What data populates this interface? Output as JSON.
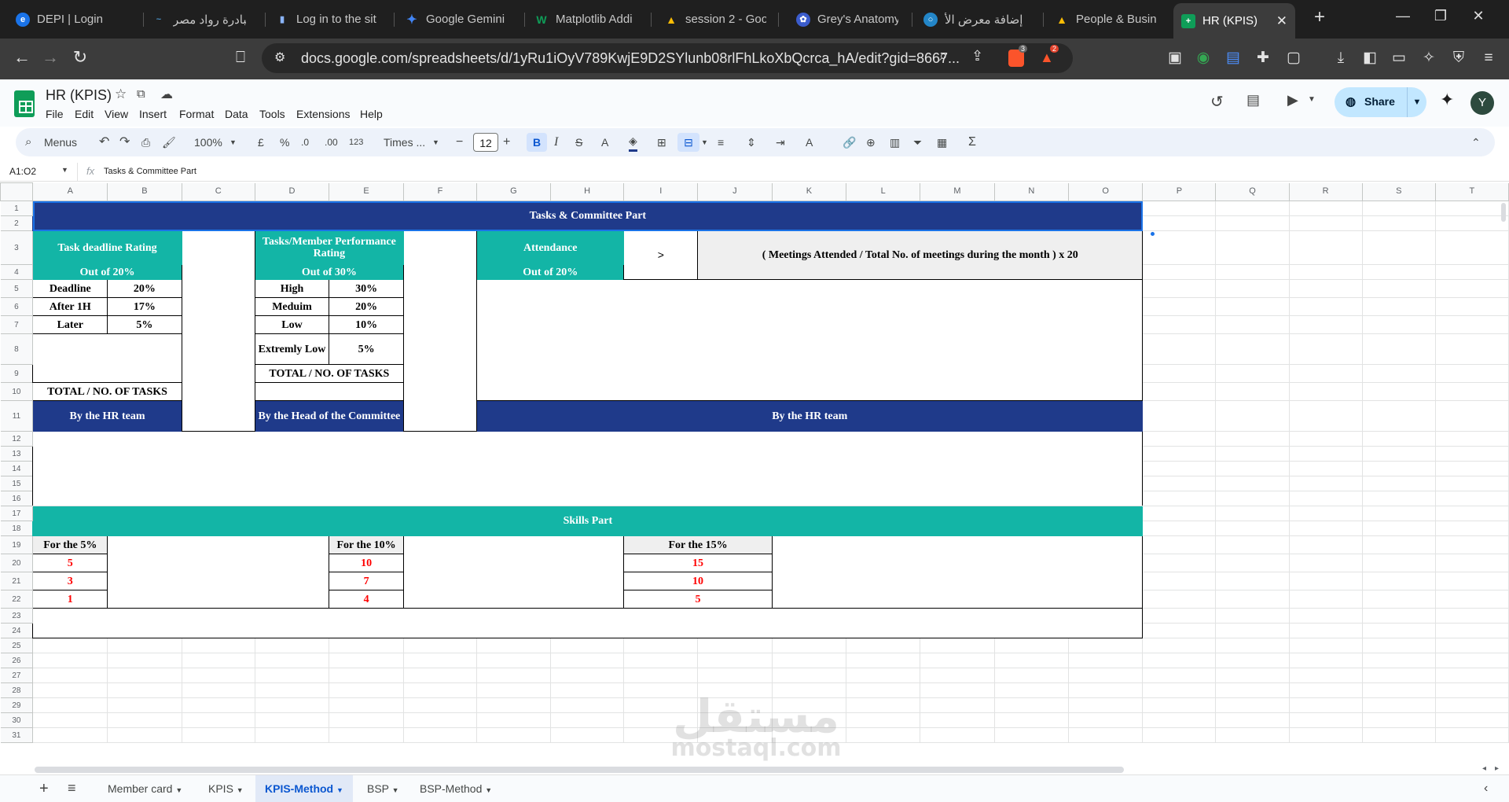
{
  "tabs": [
    {
      "title": "DEPI | Login",
      "icon": "depi-icon",
      "color": "#1a73e8",
      "glyph": "e"
    },
    {
      "title": "مبادرة رواد مصر",
      "icon": "rowad-icon",
      "color": "#4a90c4",
      "glyph": "~"
    },
    {
      "title": "Log in to the sit",
      "icon": "bookmark-icon",
      "color": "#8ab4f8",
      "glyph": "▮"
    },
    {
      "title": "Google Gemini",
      "icon": "gemini-icon",
      "color": "#4285f4",
      "glyph": "✦"
    },
    {
      "title": "Matplotlib Addi",
      "icon": "w-icon",
      "color": "#0f9d58",
      "glyph": "W"
    },
    {
      "title": "session 2 - Goo",
      "icon": "drive-icon",
      "color": "#fbbc04",
      "glyph": "▲"
    },
    {
      "title": "Grey's Anatomy",
      "icon": "grey-icon",
      "color": "#3b5ccc",
      "glyph": "✿"
    },
    {
      "title": "إضافة معرض الأ",
      "icon": "mostaql-icon",
      "color": "#2386c8",
      "glyph": "○"
    },
    {
      "title": "People & Busin",
      "icon": "drive-icon",
      "color": "#fbbc04",
      "glyph": "▲"
    },
    {
      "title": "HR (KPIS)",
      "icon": "sheets-icon",
      "color": "#0f9d58",
      "glyph": "+"
    }
  ],
  "url": "docs.google.com/spreadsheets/d/1yRu1iOyV789KwjE9D2SYlunb08rlFhLkoXbQcrca_hA/edit?gid=8667...",
  "ext_badges": {
    "brave": "3",
    "alert": "2"
  },
  "doc": {
    "title": "HR (KPIS)",
    "menus": [
      "File",
      "Edit",
      "View",
      "Insert",
      "Format",
      "Data",
      "Tools",
      "Extensions",
      "Help"
    ],
    "share_label": "Share",
    "avatar_initial": "Y"
  },
  "format_toolbar": {
    "search_label": "Menus",
    "zoom": "100%",
    "currency": "£",
    "percent": "%",
    "dec_less": ".0",
    "dec_more": ".00",
    "number_format": "123",
    "font": "Times ...",
    "font_size": "12"
  },
  "formula_bar": {
    "name_box": "A1:O2",
    "fx": "fx",
    "content": "Tasks & Committee Part"
  },
  "columns": [
    "A",
    "B",
    "C",
    "D",
    "E",
    "F",
    "G",
    "H",
    "I",
    "J",
    "K",
    "L",
    "M",
    "N",
    "O",
    "P",
    "Q",
    "R",
    "S",
    "T"
  ],
  "sheet": {
    "tasks_committee_title": "Tasks & Committee Part",
    "task_deadline": {
      "header": "Task deadline Rating",
      "subheader": "Out of 20%",
      "rows": [
        {
          "label": "Deadline",
          "value": "20%"
        },
        {
          "label": "After 1H",
          "value": "17%"
        },
        {
          "label": "Later",
          "value": "5%"
        }
      ],
      "total": "TOTAL / NO. OF TASKS",
      "footer": "By the HR team"
    },
    "performance": {
      "header": "Tasks/Member Performance Rating",
      "subheader": "Out of 30%",
      "rows": [
        {
          "label": "High",
          "value": "30%"
        },
        {
          "label": "Meduim",
          "value": "20%"
        },
        {
          "label": "Low",
          "value": "10%"
        },
        {
          "label": "Extremly Low",
          "value": "5%"
        }
      ],
      "total": "TOTAL / NO. OF TASKS",
      "footer": "By the Head of the Committee"
    },
    "attendance": {
      "header": "Attendance",
      "subheader": "Out of 20%",
      "arrow": ">",
      "formula": "( Meetings Attended / Total No. of meetings during the month ) x 20",
      "footer": "By the HR team"
    },
    "skills_title": "Skills Part",
    "skills": [
      {
        "header": "For the 5%",
        "values": [
          "5",
          "3",
          "1"
        ]
      },
      {
        "header": "For the 10%",
        "values": [
          "10",
          "7",
          "4"
        ]
      },
      {
        "header": "For the 15%",
        "values": [
          "15",
          "10",
          "5"
        ]
      }
    ]
  },
  "sheet_tabs": [
    "Member card",
    "KPIS",
    "KPIS-Method",
    "BSP",
    "BSP-Method"
  ],
  "active_sheet": "KPIS-Method",
  "watermark": {
    "arabic": "مستقل",
    "latin": "mostaql.com"
  },
  "colors": {
    "navy": "#1f3a8a",
    "teal": "#13b5a6",
    "red": "#ff0000"
  }
}
